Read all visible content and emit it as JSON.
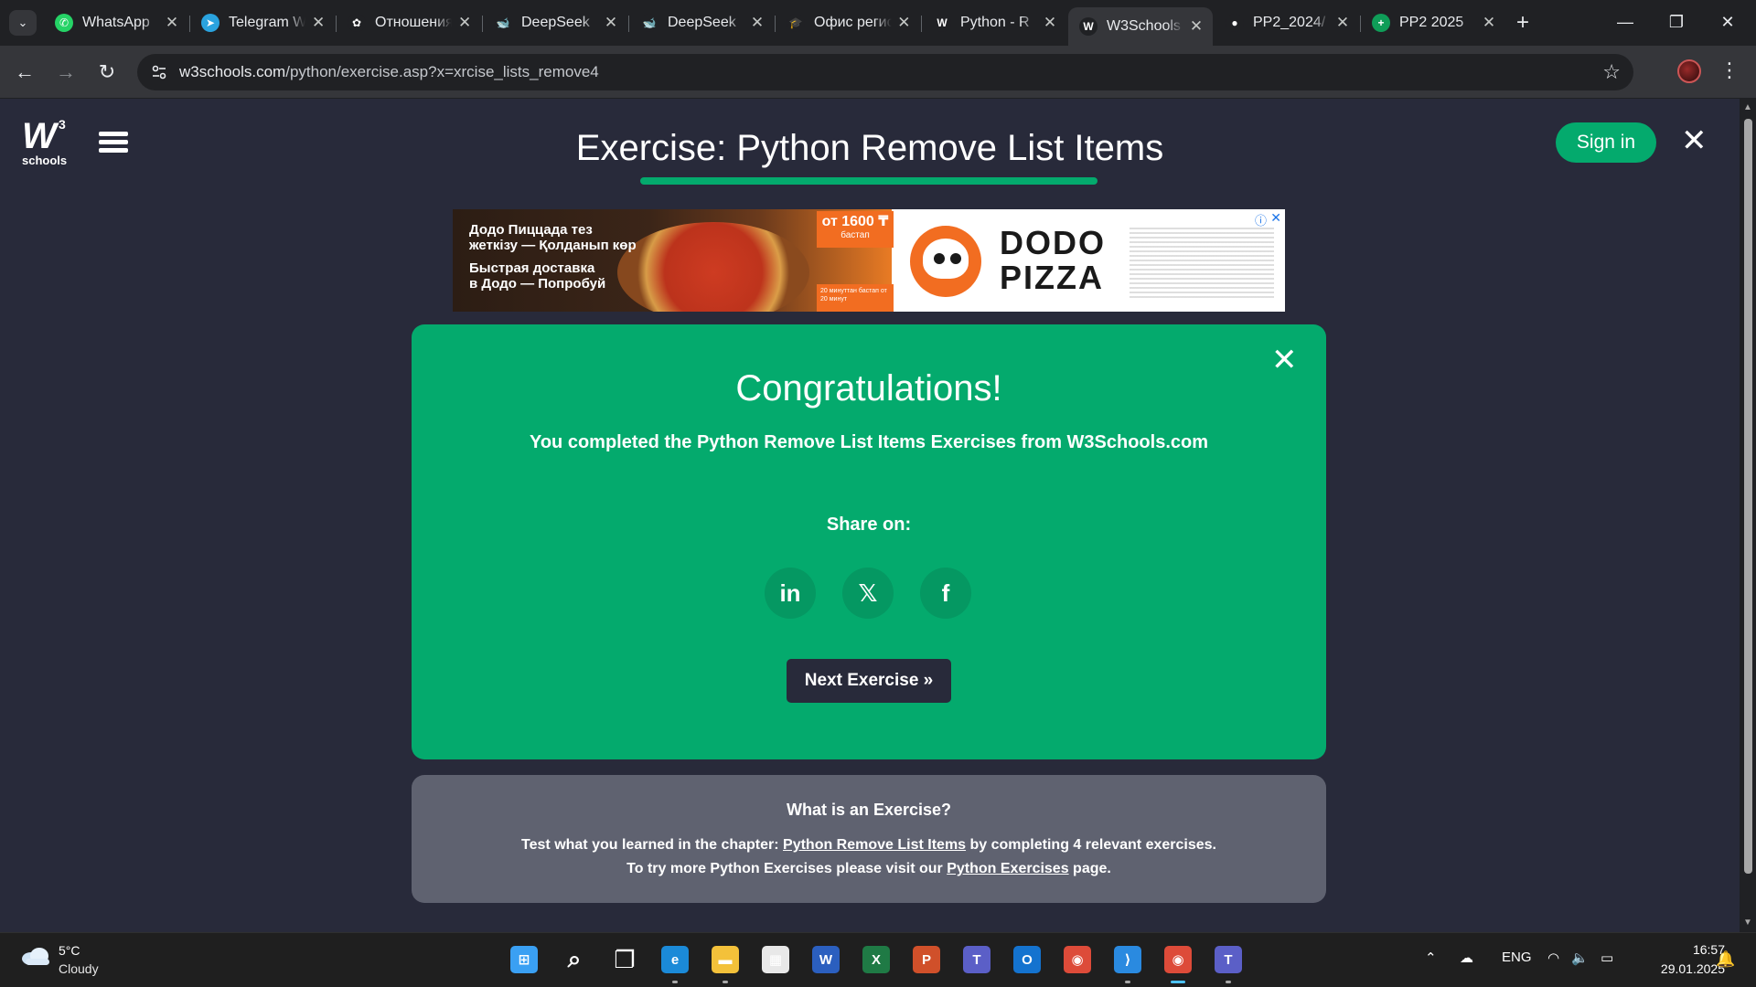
{
  "tabs": [
    {
      "title": "WhatsApp",
      "icon": "whatsapp-icon",
      "color": "#25d366",
      "glyph": "✆"
    },
    {
      "title": "Telegram W",
      "icon": "telegram-icon",
      "color": "#2aa3df",
      "glyph": "➤"
    },
    {
      "title": "Отношения",
      "icon": "openai-icon",
      "color": "#202124",
      "glyph": "✿"
    },
    {
      "title": "DeepSeek",
      "icon": "deepseek-icon",
      "color": "#202124",
      "glyph": "🐋"
    },
    {
      "title": "DeepSeek",
      "icon": "deepseek-icon",
      "color": "#202124",
      "glyph": "🐋"
    },
    {
      "title": "Офис регис",
      "icon": "graduation-cap-icon",
      "color": "#202124",
      "glyph": "🎓"
    },
    {
      "title": "Python - R",
      "icon": "w3schools-icon",
      "color": "#202124",
      "glyph": "W"
    },
    {
      "title": "W3Schools",
      "icon": "w3schools-icon",
      "color": "#202124",
      "glyph": "W"
    },
    {
      "title": "PP2_2024/",
      "icon": "github-icon",
      "color": "#202124",
      "glyph": "●"
    },
    {
      "title": "PP2 2025",
      "icon": "google-sheets-icon",
      "color": "#0f9d58",
      "glyph": "+"
    }
  ],
  "active_tab_index": 7,
  "address_bar": {
    "host": "w3schools.com",
    "path": "/python/exercise.asp?x=xrcise_lists_remove4"
  },
  "header": {
    "logo_text": "W",
    "logo_sup": "3",
    "logo_sub": "schools",
    "title": "Exercise: Python Remove List Items",
    "signin_label": "Sign in"
  },
  "ad": {
    "line1": "Додо Пиццада тез",
    "line2": "жеткізу — Қолданып көр",
    "line3": "Быстрая доставка",
    "line4": "в Додо — Попробуй",
    "price": "от 1600 ₸",
    "price_note": "бастап",
    "timer_text": "20 минуттан бастап от 20 минут",
    "brand_line1": "DODO",
    "brand_line2": "PIZZA"
  },
  "congrats": {
    "title": "Congratulations!",
    "message": "You completed the Python Remove List Items Exercises from W3Schools.com",
    "share_label": "Share on:",
    "share_buttons": [
      {
        "label": "in",
        "icon": "linkedin-icon"
      },
      {
        "label": "𝕏",
        "icon": "x-twitter-icon"
      },
      {
        "label": "f",
        "icon": "facebook-icon"
      }
    ],
    "next_label": "Next Exercise »"
  },
  "info": {
    "title": "What is an Exercise?",
    "line1_pre": "Test what you learned in the chapter: ",
    "line1_link": "Python Remove List Items",
    "line1_post": " by completing 4 relevant exercises.",
    "line2_pre": "To try more Python Exercises please visit our ",
    "line2_link": "Python Exercises",
    "line2_post": " page."
  },
  "taskbar": {
    "weather_temp": "5°C",
    "weather_desc": "Cloudy",
    "apps": [
      {
        "name": "start-icon",
        "color": "#3aa0f3",
        "glyph": "⊞"
      },
      {
        "name": "search-icon",
        "color": "transparent",
        "glyph": "⌕"
      },
      {
        "name": "task-view-icon",
        "color": "transparent",
        "glyph": "❐"
      },
      {
        "name": "edge-icon",
        "color": "#1b8ad8",
        "glyph": "e"
      },
      {
        "name": "file-explorer-icon",
        "color": "#f3c13a",
        "glyph": "▬"
      },
      {
        "name": "store-icon",
        "color": "#e8e8e8",
        "glyph": "▦"
      },
      {
        "name": "word-icon",
        "color": "#2b5fbf",
        "glyph": "W"
      },
      {
        "name": "excel-icon",
        "color": "#1f7a45",
        "glyph": "X"
      },
      {
        "name": "powerpoint-icon",
        "color": "#d0502a",
        "glyph": "P"
      },
      {
        "name": "teams-icon",
        "color": "#5b5fc7",
        "glyph": "T"
      },
      {
        "name": "outlook-icon",
        "color": "#1473cf",
        "glyph": "O"
      },
      {
        "name": "chrome-icon",
        "color": "#dd4b39",
        "glyph": "◉"
      },
      {
        "name": "vscode-icon",
        "color": "#2a8ae0",
        "glyph": "⟩"
      },
      {
        "name": "chrome-profile-icon",
        "color": "#dd4b39",
        "glyph": "◉"
      },
      {
        "name": "teams-new-icon",
        "color": "#5b5fc7",
        "glyph": "T"
      }
    ],
    "language": "ENG",
    "time": "16:57",
    "date": "29.01.2025"
  }
}
